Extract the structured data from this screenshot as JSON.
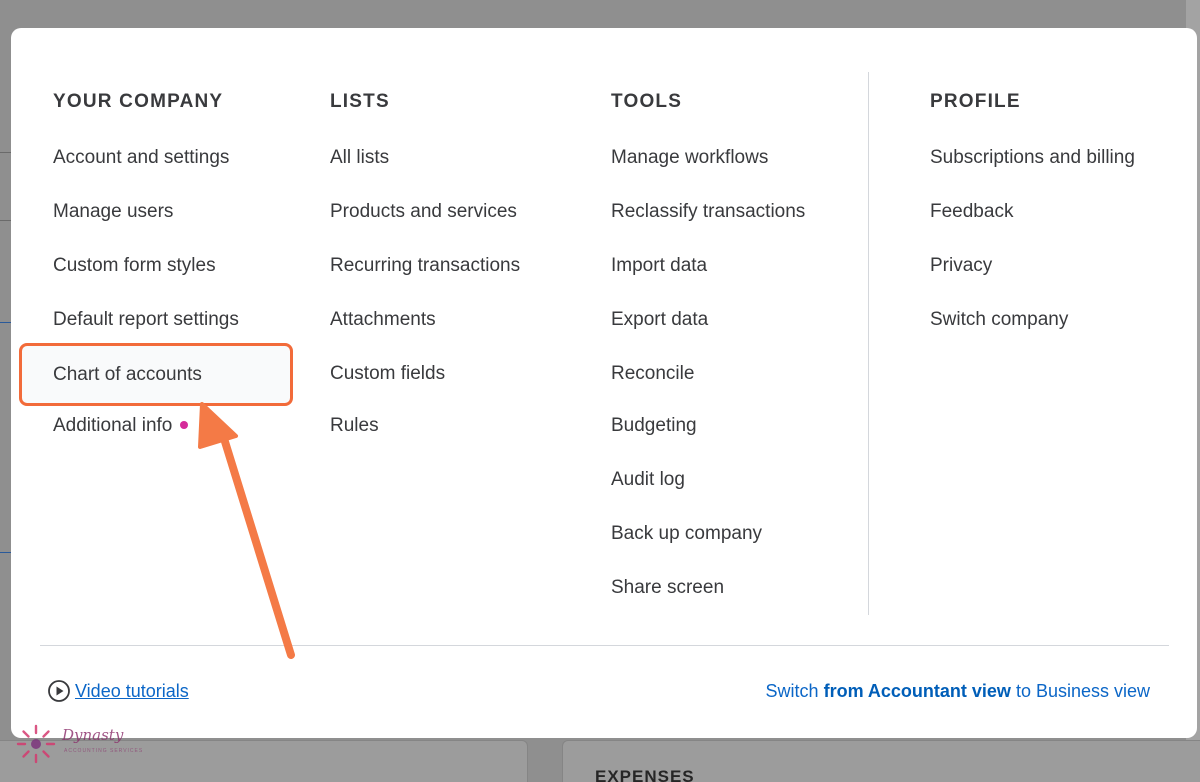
{
  "background": {
    "card_label": "EXPENSES"
  },
  "columns": [
    {
      "heading": "YOUR COMPANY",
      "items": [
        "Account and settings",
        "Manage users",
        "Custom form styles",
        "Default report settings",
        "Chart of accounts",
        "Additional info"
      ]
    },
    {
      "heading": "LISTS",
      "items": [
        "All lists",
        "Products and services",
        "Recurring transactions",
        "Attachments",
        "Custom fields",
        "Rules"
      ]
    },
    {
      "heading": "TOOLS",
      "items": [
        "Manage workflows",
        "Reclassify transactions",
        "Import data",
        "Export data",
        "Reconcile",
        "Budgeting",
        "Audit log",
        "Back up company",
        "Share screen"
      ]
    },
    {
      "heading": "PROFILE",
      "items": [
        "Subscriptions and billing",
        "Feedback",
        "Privacy",
        "Switch company"
      ]
    }
  ],
  "footer": {
    "video_link": "Video tutorials",
    "switch_prefix": "Switch ",
    "switch_from": "from Accountant view",
    "switch_mid": " to ",
    "switch_to": "Business view"
  },
  "watermark": {
    "brand": "Dynasty",
    "tagline": "ACCOUNTING SERVICES"
  },
  "colors": {
    "accent_link": "#0b66c7",
    "highlight_border": "#f26b3a",
    "notification_dot": "#d52b9a"
  },
  "icons": [
    "play-circle-icon",
    "callout-arrow-icon",
    "dot-indicator-icon"
  ]
}
